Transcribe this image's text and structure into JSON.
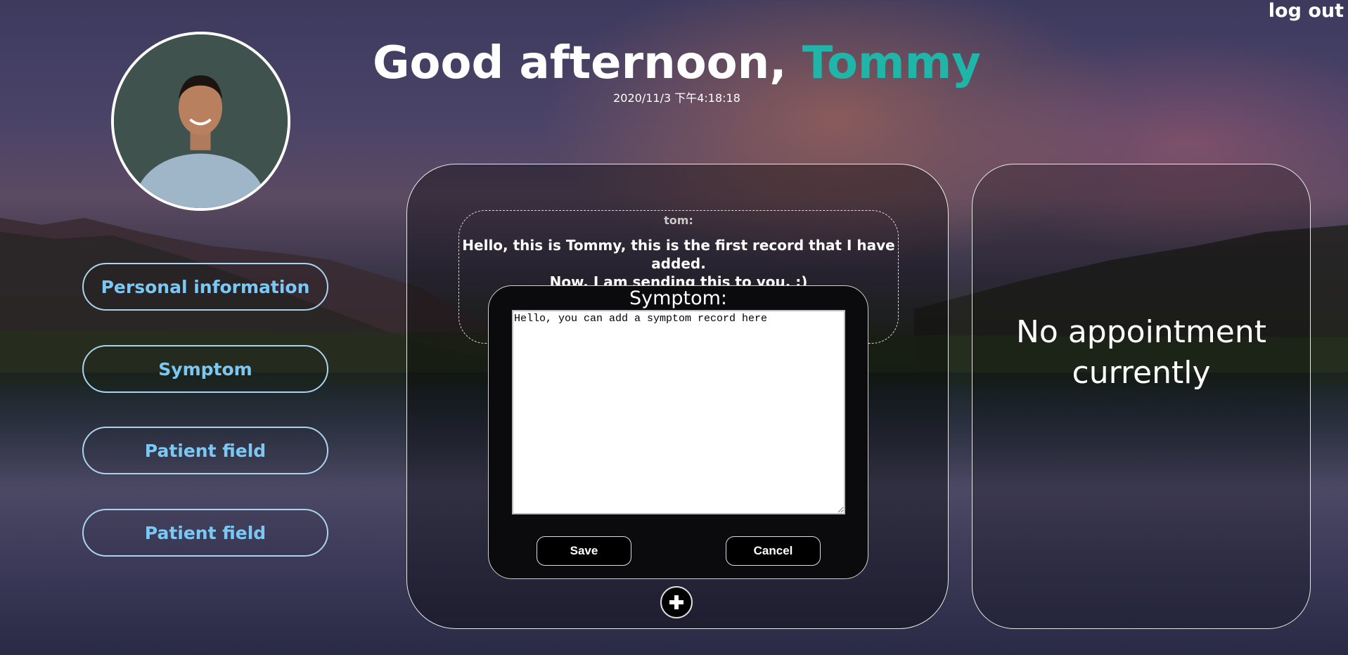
{
  "header": {
    "logout_label": "log out",
    "greeting_prefix": "Good afternoon,",
    "user_name": "Tommy",
    "datetime": "2020/11/3 下午4:18:18"
  },
  "sidebar": {
    "items": [
      {
        "label": "Personal information"
      },
      {
        "label": "Symptom"
      },
      {
        "label": "Patient field"
      },
      {
        "label": "Patient field"
      }
    ]
  },
  "record": {
    "author": "tom:",
    "text_line1": "Hello, this is Tommy, this is the first record that I have added.",
    "text_line2": "Now, I am sending this to you. :)"
  },
  "symptom_editor": {
    "title": "Symptom:",
    "value": "Hello, you can add a symptom record here",
    "save_label": "Save",
    "cancel_label": "Cancel"
  },
  "appointments": {
    "empty_line1": "No appointment",
    "empty_line2": "currently"
  },
  "colors": {
    "accent_name": "#1fb5a8",
    "nav_text": "#7cc8f4"
  },
  "icons": {
    "add": "plus-icon"
  }
}
